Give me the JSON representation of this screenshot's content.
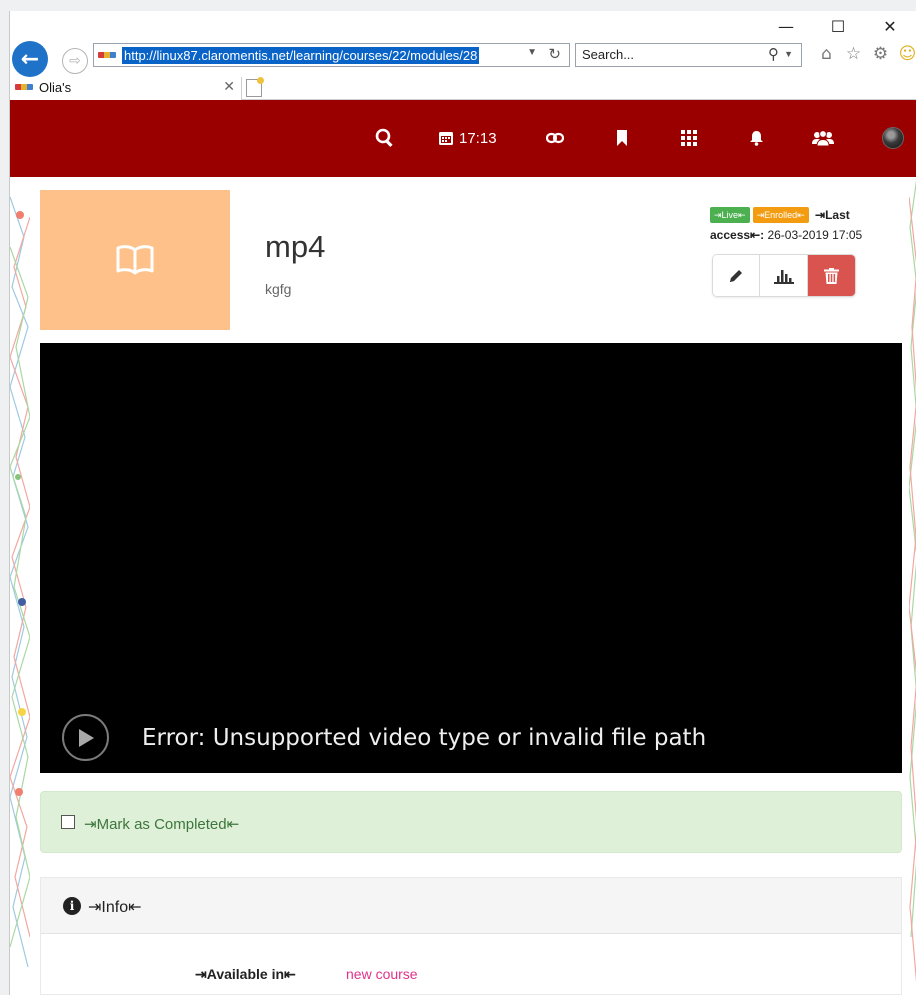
{
  "browser": {
    "window_controls": {
      "minimize": "—",
      "maximize": "☐",
      "close": "✕"
    },
    "address": {
      "url": "http://linux87.claromentis.net/learning/courses/22/modules/28"
    },
    "search": {
      "placeholder": "Search..."
    },
    "tab": {
      "label": "Olia's",
      "close": "✕"
    }
  },
  "header": {
    "clock": "17:13"
  },
  "module": {
    "title": "mp4",
    "description": "kgfg",
    "badge_live": "⇥Live⇤",
    "badge_enrolled": "⇥Enrolled⇤",
    "last_access_label": "⇥Last access⇤:",
    "last_access_value": "26-03-2019 17:05"
  },
  "video": {
    "error": "Error: Unsupported video type or invalid file path"
  },
  "completion": {
    "label": "⇥Mark as Completed⇤"
  },
  "info": {
    "title": "⇥Info⇤",
    "available_label": "⇥Available in⇤",
    "available_link": "new course"
  },
  "colors": {
    "header_bg": "#9b0000",
    "thumb_bg": "#ffc18a",
    "delete_btn": "#d9534f",
    "live_badge": "#4caf50",
    "enrolled_badge": "#f39c12",
    "completed_bg": "#dff0d8",
    "link": "#e0338a"
  }
}
